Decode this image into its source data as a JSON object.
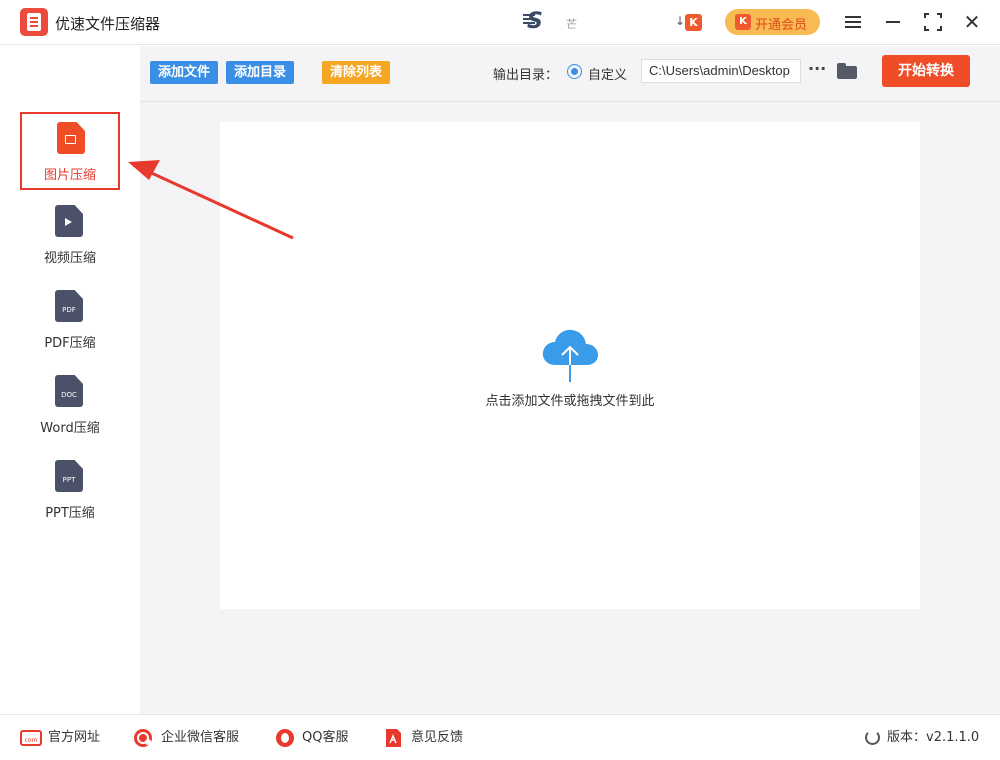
{
  "app": {
    "title": "优速文件压缩器",
    "brand_dot": "芒"
  },
  "header": {
    "vip_arrow": "↓",
    "vip_k": "K",
    "vip_button_label": "开通会员"
  },
  "sidebar": {
    "items": [
      {
        "label": "图片压缩",
        "icon": "image-file-icon",
        "active": true
      },
      {
        "label": "视频压缩",
        "icon": "video-file-icon",
        "active": false
      },
      {
        "label": "PDF压缩",
        "icon": "pdf-file-icon",
        "tag": "PDF",
        "active": false
      },
      {
        "label": "Word压缩",
        "icon": "doc-file-icon",
        "tag": "DOC",
        "active": false
      },
      {
        "label": "PPT压缩",
        "icon": "ppt-file-icon",
        "tag": "PPT",
        "active": false
      }
    ]
  },
  "toolbar": {
    "add_file": "添加文件",
    "add_folder": "添加目录",
    "clear_list": "清除列表",
    "output_label": "输出目录：",
    "radio_label": "自定义",
    "output_path": "C:\\Users\\admin\\Desktop",
    "more": "···",
    "start": "开始转换"
  },
  "dropzone": {
    "hint": "点击添加文件或拖拽文件到此"
  },
  "footer": {
    "website": "官方网址",
    "wechat": "企业微信客服",
    "qq": "QQ客服",
    "feedback": "意见反馈",
    "version": "版本：v2.1.1.0"
  },
  "colors": {
    "accent_red": "#ef4d28",
    "accent_blue": "#3a8ee6",
    "accent_orange": "#f5a623",
    "vip_bg": "#f8ba52",
    "annotation_red": "#e8392e"
  }
}
